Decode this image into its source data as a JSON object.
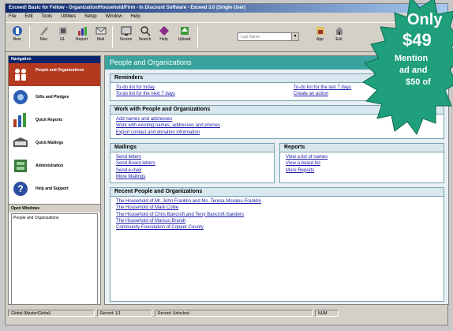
{
  "window": {
    "title": "Exceed! Basic for Fellow - Organization/Household/Firm - In Discount Software - Exceed 3.0 (Single User)"
  },
  "menu": [
    "File",
    "Edit",
    "Tools",
    "Utilities",
    "Setup",
    "Window",
    "Help"
  ],
  "toolbar": {
    "buttons": [
      "New",
      "Mac",
      "GL",
      "Report",
      "Mail",
      "Screen",
      "Search",
      "Help",
      "Upload",
      "App",
      "Exit"
    ],
    "combo_placeholder": "Last Name"
  },
  "nav": {
    "header": "Navigation",
    "items": [
      {
        "label": "People and Organizations",
        "icon": "people-icon"
      },
      {
        "label": "Gifts and Pledges",
        "icon": "gifts-icon"
      },
      {
        "label": "Quick Reports",
        "icon": "reports-icon"
      },
      {
        "label": "Quick Mailings",
        "icon": "mailings-icon"
      },
      {
        "label": "Administration",
        "icon": "administration-icon"
      },
      {
        "label": "Help and Support",
        "icon": "help-icon"
      }
    ],
    "open_windows_header": "Open Windows",
    "open_windows": [
      "People and Organizations"
    ]
  },
  "main": {
    "title": "People and Organizations",
    "reminders": {
      "header": "Reminders",
      "left": [
        "To-do list for today",
        "To-do list for the next 7 days"
      ],
      "right": [
        "To-do list for the last 7 days",
        "Create an action"
      ]
    },
    "work": {
      "header": "Work with People and Organizations",
      "links": [
        "Add names and addresses",
        "Work with existing names, addresses and phones",
        "Export contact and donation information"
      ]
    },
    "mailings": {
      "header": "Mailings",
      "links": [
        "Send letters",
        "Send Board letters",
        "Send e-mail",
        "More Mailings"
      ]
    },
    "reports": {
      "header": "Reports",
      "links": [
        "View a list of names",
        "View a board list",
        "More Reports"
      ]
    },
    "recent": {
      "header": "Recent People and Organizations",
      "links": [
        "The Household of Mr. John Franklin and Ms. Teresa Morales-Franklin",
        "The Household of Mark Collie",
        "The Household of Chris Bancroft and Terry Bancroft-Sanders",
        "The Household of Marcus Brandt",
        "Community Foundation of Copper County"
      ]
    }
  },
  "status": {
    "cells": [
      "Global (Master/Global)",
      "Record: 1/1",
      "Record: Unlocked",
      "NUM"
    ]
  },
  "promo": {
    "line1": "Only",
    "line2": "$49",
    "line3": "Mention",
    "line4": "ad and",
    "line5": "$50 of"
  },
  "colors": {
    "teal_header": "#3aa39e",
    "burst_green": "#1f9f7b",
    "selected_nav": "#b33a1f"
  }
}
